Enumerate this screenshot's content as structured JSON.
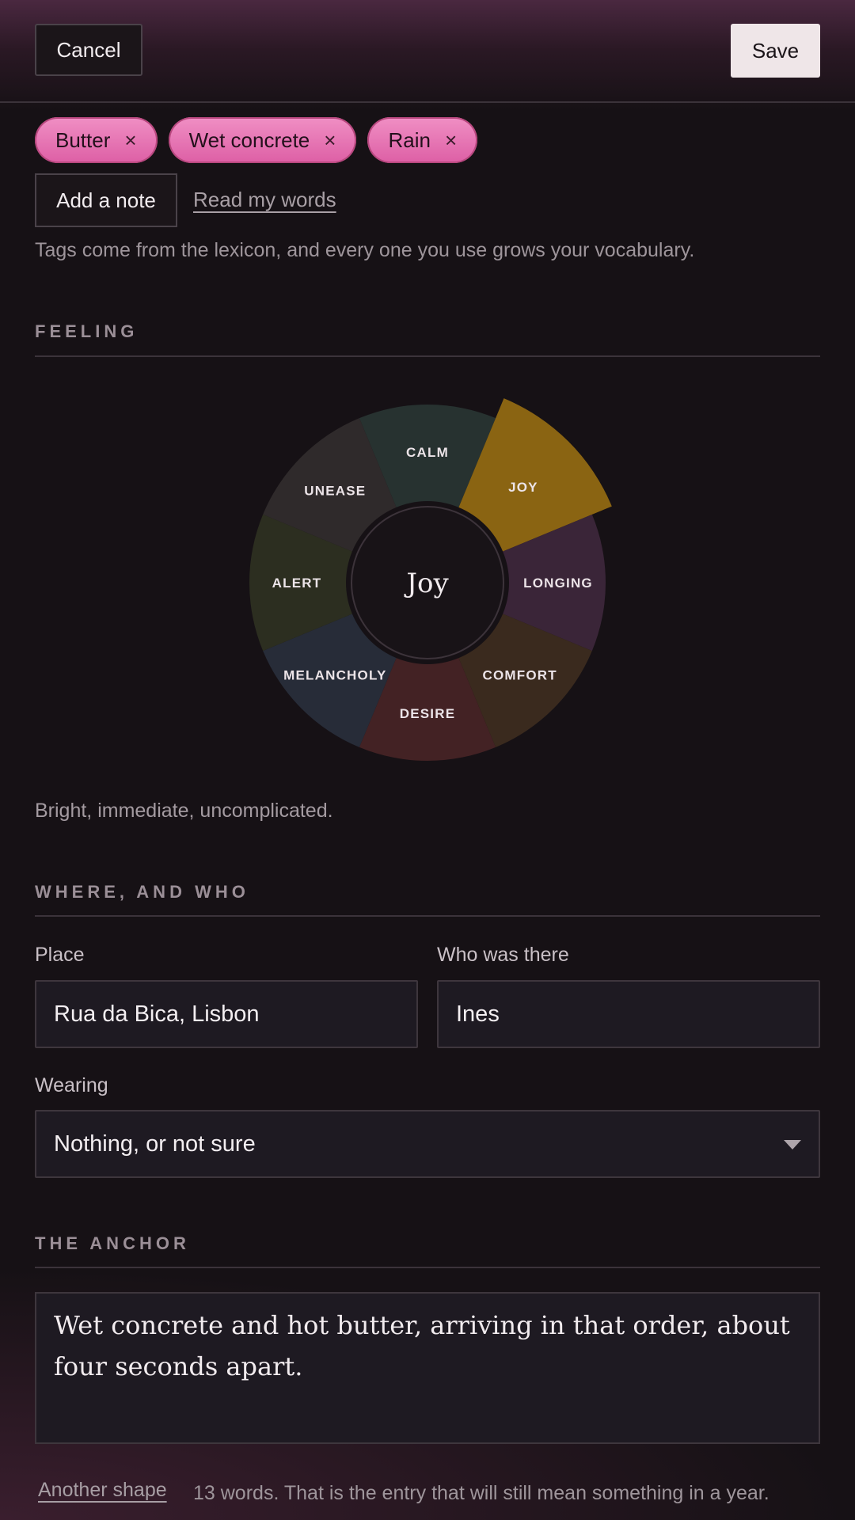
{
  "header": {
    "cancel_label": "Cancel",
    "save_label": "Save"
  },
  "tags": [
    {
      "label": "Butter",
      "remove": "×"
    },
    {
      "label": "Wet concrete",
      "remove": "×"
    },
    {
      "label": "Rain",
      "remove": "×"
    }
  ],
  "actions": {
    "add_note_label": "Add a note",
    "read_words_label": "Read my words"
  },
  "helper_text": "Tags come from the lexicon, and every one you use grows your vocabulary.",
  "feeling": {
    "section_label": "FEELING",
    "segments": [
      {
        "label": "CALM",
        "color": "#273230"
      },
      {
        "label": "JOY",
        "color": "#8a6412"
      },
      {
        "label": "LONGING",
        "color": "#3a2538"
      },
      {
        "label": "COMFORT",
        "color": "#3a2a1e"
      },
      {
        "label": "DESIRE",
        "color": "#432224"
      },
      {
        "label": "MELANCHOLY",
        "color": "#272c38"
      },
      {
        "label": "ALERT",
        "color": "#2c2e20"
      },
      {
        "label": "UNEASE",
        "color": "#2f2a2b"
      }
    ],
    "selected": "Joy",
    "description": "Bright, immediate, uncomplicated."
  },
  "where_who": {
    "section_label": "WHERE, AND WHO",
    "place_label": "Place",
    "place_value": "Rua da Bica, Lisbon",
    "who_label": "Who was there",
    "who_value": "Ines",
    "wearing_label": "Wearing",
    "wearing_value": "Nothing, or not sure"
  },
  "anchor": {
    "section_label": "THE ANCHOR",
    "text": "Wet concrete and hot butter, arriving in that order, about four seconds apart.",
    "another_shape_label": "Another shape",
    "word_count_text": "13 words. That is the entry that will still mean something in a year."
  },
  "colors": {
    "accent_pink": "#e56aae",
    "joy_gold": "#8a6412",
    "background": "#161115"
  }
}
